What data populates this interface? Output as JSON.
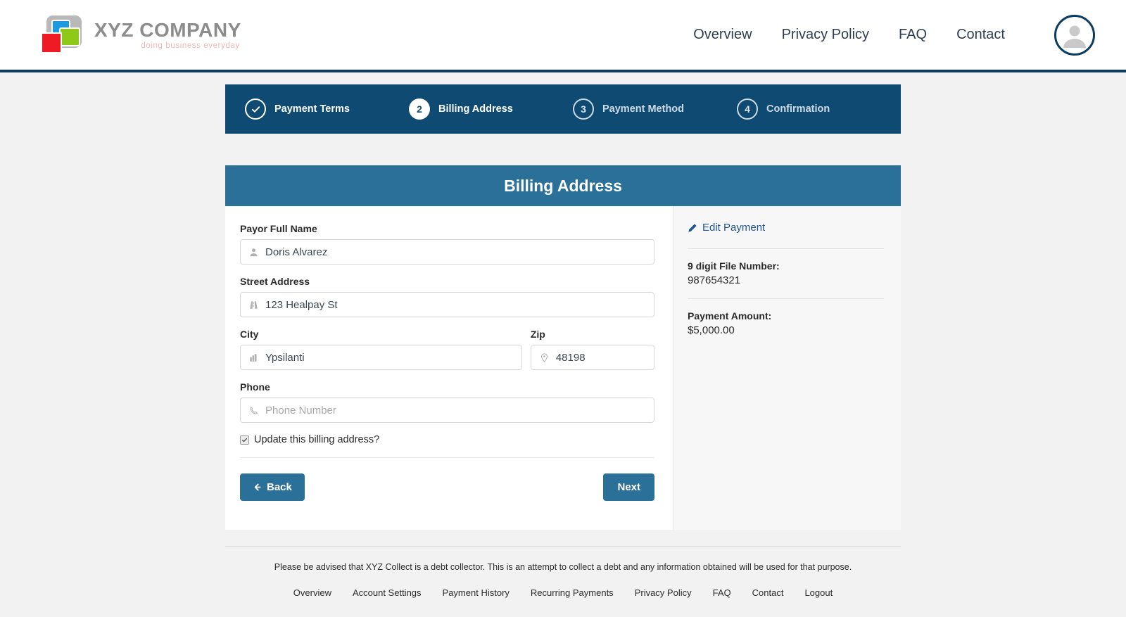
{
  "header": {
    "brand": {
      "name": "XYZ COMPANY",
      "tagline": "doing business everyday"
    },
    "nav": [
      {
        "label": "Overview"
      },
      {
        "label": "Privacy Policy"
      },
      {
        "label": "FAQ"
      },
      {
        "label": "Contact"
      }
    ],
    "avatar_icon": "user-avatar-icon"
  },
  "steps": [
    {
      "badge": "✓",
      "label": "Payment Terms",
      "state": "done"
    },
    {
      "badge": "2",
      "label": "Billing Address",
      "state": "current"
    },
    {
      "badge": "3",
      "label": "Payment Method",
      "state": "upcoming"
    },
    {
      "badge": "4",
      "label": "Confirmation",
      "state": "upcoming"
    }
  ],
  "card": {
    "title": "Billing Address",
    "fields": {
      "payor": {
        "label": "Payor Full Name",
        "value": "Doris Alvarez",
        "placeholder": "Payor Full Name",
        "icon": "user-icon"
      },
      "street": {
        "label": "Street Address",
        "value": "123 Healpay St",
        "placeholder": "Street Address",
        "icon": "road-icon"
      },
      "city": {
        "label": "City",
        "value": "Ypsilanti",
        "placeholder": "City",
        "icon": "city-icon"
      },
      "zip": {
        "label": "Zip",
        "value": "48198",
        "placeholder": "Zip",
        "icon": "map-pin-icon"
      },
      "phone": {
        "label": "Phone",
        "value": "",
        "placeholder": "Phone Number",
        "icon": "phone-icon"
      }
    },
    "checkbox": {
      "label": "Update this billing address?",
      "checked": true
    },
    "back_label": "Back",
    "next_label": "Next"
  },
  "sidebar": {
    "edit_link": "Edit Payment",
    "file_number_label": "9 digit File Number:",
    "file_number_value": "987654321",
    "payment_amount_label": "Payment Amount:",
    "payment_amount_value": "$5,000.00"
  },
  "footer": {
    "disclaimer": "Please be advised that XYZ Collect is a debt collector. This is an attempt to collect a debt and any information obtained will be used for that purpose.",
    "links": [
      {
        "label": "Overview"
      },
      {
        "label": "Account Settings"
      },
      {
        "label": "Payment History"
      },
      {
        "label": "Recurring Payments"
      },
      {
        "label": "Privacy Policy"
      },
      {
        "label": "FAQ"
      },
      {
        "label": "Contact"
      },
      {
        "label": "Logout"
      }
    ]
  },
  "colors": {
    "header_border": "#0d3c61",
    "steps_bar": "#0e4a72",
    "card_header": "#2a7099",
    "button": "#2a7099",
    "link": "#21548a"
  }
}
